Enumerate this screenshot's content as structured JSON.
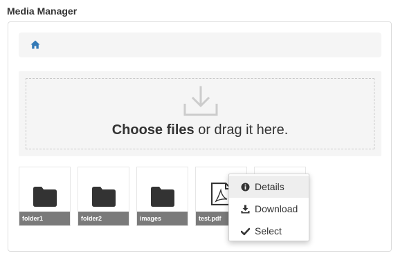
{
  "page": {
    "title": "Media Manager"
  },
  "breadcrumb": {
    "home_icon": "home-icon"
  },
  "dropzone": {
    "icon": "download-tray-icon",
    "bold_text": "Choose files",
    "rest_text": " or drag it here."
  },
  "files": [
    {
      "name": "folder1",
      "type": "folder",
      "icon": "folder-icon"
    },
    {
      "name": "folder2",
      "type": "folder",
      "icon": "folder-icon"
    },
    {
      "name": "images",
      "type": "folder",
      "icon": "folder-icon"
    },
    {
      "name": "test.pdf",
      "type": "pdf",
      "icon": "pdf-file-icon"
    },
    {
      "name": "",
      "type": "file",
      "icon": "file-icon"
    }
  ],
  "context_menu": {
    "items": [
      {
        "label": "Details",
        "icon": "info-circle-icon",
        "highlighted": true
      },
      {
        "label": "Download",
        "icon": "download-icon",
        "highlighted": false
      },
      {
        "label": "Select",
        "icon": "check-icon",
        "highlighted": false
      }
    ]
  },
  "colors": {
    "accent": "#337ab7",
    "panel_bg": "#f5f5f5",
    "tile_label_bg": "#7a7a7a",
    "icon_dark": "#333333"
  }
}
